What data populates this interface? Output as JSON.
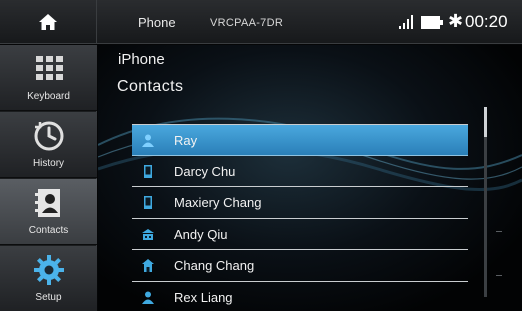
{
  "topbar": {
    "home_icon": "home-icon",
    "source": "Phone",
    "device": "VRCPAA-7DR",
    "signal_icon": "signal-icon",
    "battery_icon": "battery-icon",
    "bluetooth_icon": "bluetooth-icon",
    "time": "00:20"
  },
  "sidebar": {
    "items": [
      {
        "label": "Keyboard",
        "icon": "keypad-icon",
        "active": false
      },
      {
        "label": "History",
        "icon": "history-icon",
        "active": false
      },
      {
        "label": "Contacts",
        "icon": "contacts-icon",
        "active": true
      },
      {
        "label": "Setup",
        "icon": "gear-icon",
        "active": false
      }
    ]
  },
  "main": {
    "device_name": "iPhone",
    "section_title": "Contacts",
    "contacts": [
      {
        "name": "Ray",
        "icon": "person-icon",
        "selected": true
      },
      {
        "name": "Darcy Chu",
        "icon": "mobile-phone-icon",
        "selected": false
      },
      {
        "name": "Maxiery Chang",
        "icon": "mobile-phone-icon",
        "selected": false
      },
      {
        "name": "Andy Qiu",
        "icon": "office-phone-icon",
        "selected": false
      },
      {
        "name": "Chang Chang",
        "icon": "home-phone-icon",
        "selected": false
      },
      {
        "name": "Rex Liang",
        "icon": "person-icon",
        "selected": false
      }
    ]
  },
  "colors": {
    "selected_row": "#3a98d0",
    "accent_blue": "#3fa9e0"
  }
}
